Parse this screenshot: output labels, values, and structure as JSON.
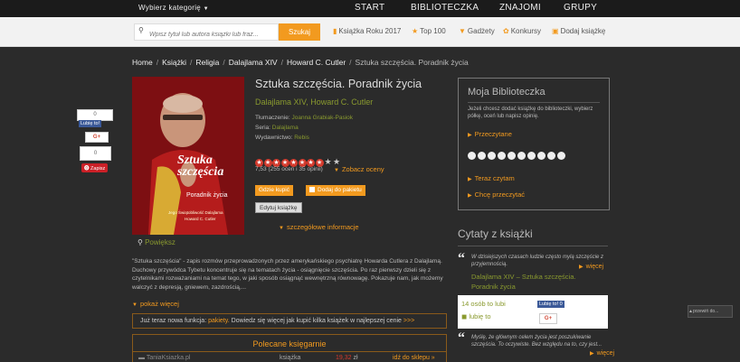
{
  "nav": {
    "category_label": "Wybierz kategorię",
    "items": [
      "START",
      "BIBLIOTECZKA",
      "ZNAJOMI",
      "GRUPY"
    ]
  },
  "search": {
    "placeholder": "Wpisz tytuł lub autora książki lub fraz...",
    "button": "Szukaj"
  },
  "toplinks": [
    "Książka Roku 2017",
    "Top 100",
    "Gadżety",
    "Konkursy",
    "Dodaj książkę"
  ],
  "breadcrumb": [
    "Home",
    "Książki",
    "Religia",
    "Dalajlama XIV",
    "Howard C. Cutler",
    "Sztuka szczęścia. Poradnik życia"
  ],
  "cover": {
    "title": "Sztuka szczęścia",
    "subtitle": "Poradnik życia",
    "authors": "Jego Świątobliwość Dalajlama",
    "coauthor": "Howard C. Cutler"
  },
  "book": {
    "title": "Sztuka szczęścia. Poradnik życia",
    "authors": "Dalajlama XIV, Howard C. Cutler",
    "translator_label": "Tłumaczenie:",
    "translator": "Joanna Grabiak-Pasiok",
    "series_label": "Seria:",
    "series": "Dalajlama",
    "publisher_label": "Wydawnictwo:",
    "publisher": "Rebis",
    "rating_value": 7.53,
    "rating_text": "7,53 (255 ocen i 35 opinii)",
    "see_ratings": "Zobacz oceny",
    "btn_buy": "Gdzie kupić",
    "btn_add": "Dodaj do pakietu",
    "btn_edit": "Edytuj książkę",
    "details": "szczegółowe informacje",
    "preview": "Powiększ",
    "description": "\"Sztuka szczęścia\" - zapis rozmów przeprowadzonych przez amerykańskiego psychiatrę Howarda Cutlera z Dalajlamą. Duchowy przywódca Tybetu koncentruje się na tematach życia - osiągnięcie szczęścia. Po raz pierwszy dzieli się z czytelnikami rozważaniami na temat tego, w jaki sposób osiągnąć wewnętrzną równowagę. Pokazuje nam, jak możemy walczyć z depresją, gniewem, zazdrością,...",
    "more": "pokaż więcej"
  },
  "notice": {
    "before": "Już teraz nowa funkcja: ",
    "highlight": "pakiety.",
    "after": " Dowiedz się więcej jak kupić kilka książek w najlepszej cenie ",
    "arrow": ">>>"
  },
  "shops": {
    "title": "Polecane księgarnie",
    "row": [
      "TaniaKsiazka.pl",
      "książka",
      "19,32",
      "zł",
      "idź do sklepu »"
    ]
  },
  "library": {
    "title": "Moja Biblioteczka",
    "text": "Jeżeli chcesz dodać książkę do biblioteczki, wybierz półkę, oceń lub napisz opinię.",
    "read": "Przeczytane",
    "reading": "Teraz czytam",
    "want": "Chcę przeczytać"
  },
  "quotes": {
    "title": "Cytaty z książki",
    "q1": "W dzisiejszych czasach ludzie często mylą szczęście z przyjemnością.",
    "more": "więcej",
    "source_prefix": "Dalajlama XIV – ",
    "source": "Sztuka szczęścia. Poradnik życia",
    "likes_count": "14 osób to lubi",
    "like_it": "lubię to",
    "q2": "Myślę, że głównym celem życia jest poszukiwanie szczęścia. To oczywiste. Bez względu na to, czy jest..."
  },
  "share": {
    "count1": "0",
    "fb": "Lubię to!",
    "gplus": "G+",
    "count2": "0",
    "pin": "Zapisz",
    "fb2": "Lubię to! 0",
    "gplus2": "G+"
  },
  "corner_badge": "przewiń do..."
}
